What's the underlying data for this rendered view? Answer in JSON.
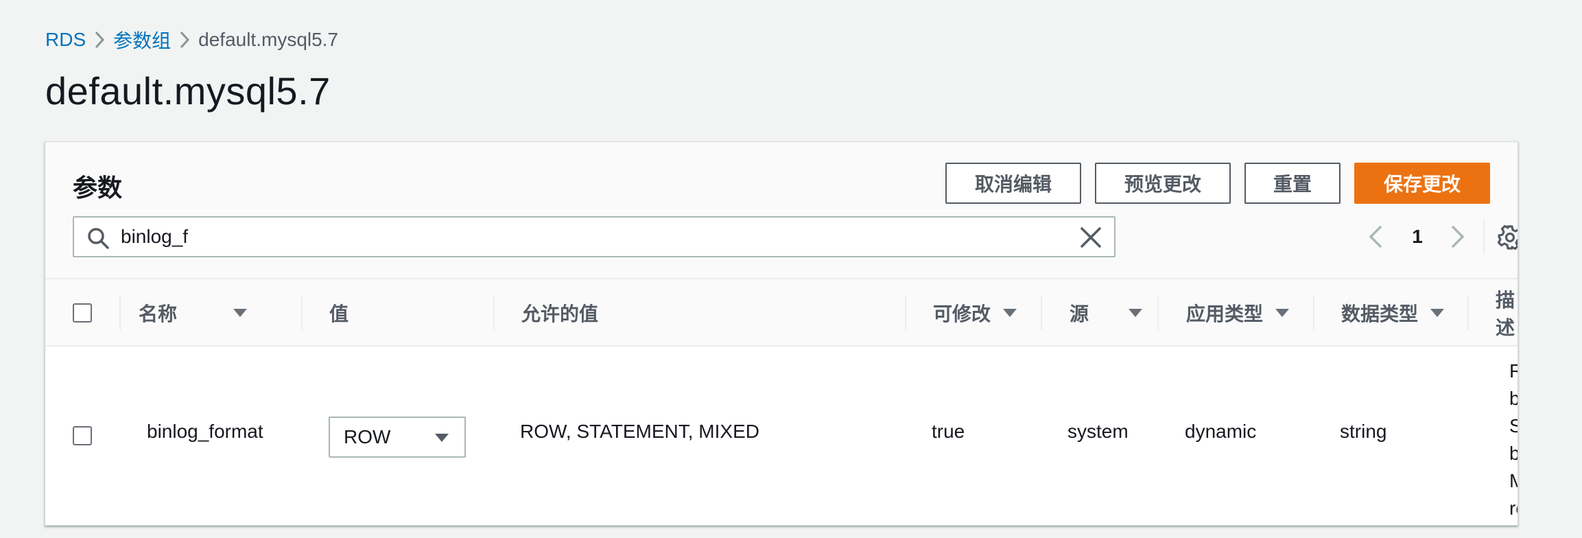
{
  "breadcrumb": {
    "root": "RDS",
    "parent": "参数组",
    "current": "default.mysql5.7"
  },
  "page_title": "default.mysql5.7",
  "section": {
    "title": "参数",
    "buttons": {
      "cancel": "取消编辑",
      "preview": "预览更改",
      "reset": "重置",
      "save": "保存更改"
    }
  },
  "search": {
    "value": "binlog_f"
  },
  "pagination": {
    "current_page": "1"
  },
  "table": {
    "headers": {
      "name": "名称",
      "value": "值",
      "allowed": "允许的值",
      "modifiable": "可修改",
      "source": "源",
      "apply_type": "应用类型",
      "data_type": "数据类型",
      "description": "描述"
    },
    "rows": [
      {
        "name": "binlog_format",
        "value": "ROW",
        "allowed": "ROW, STATEMENT, MIXED",
        "modifiable": "true",
        "source": "system",
        "apply_type": "dynamic",
        "data_type": "string",
        "description_lines": [
          "Row-",
          "based,",
          "Statement-",
          "based or",
          "Mixed",
          "replication"
        ]
      }
    ]
  },
  "colors": {
    "link": "#0073bb",
    "primary_button": "#ec7211",
    "background": "#f2f3f3"
  },
  "icons": [
    "chevron-right-icon",
    "search-icon",
    "close-icon",
    "chevron-left-icon",
    "gear-icon",
    "caret-down-icon"
  ]
}
